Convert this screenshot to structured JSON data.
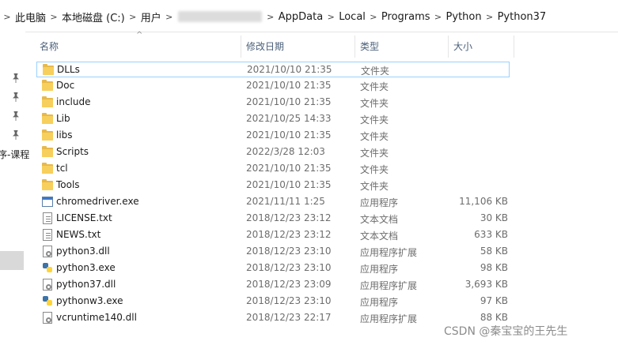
{
  "address": {
    "crumbs": [
      "此电脑",
      "本地磁盘 (C:)",
      "用户",
      "AppData",
      "Local",
      "Programs",
      "Python",
      "Python37"
    ],
    "separator": ">"
  },
  "columns": {
    "name": "名称",
    "date": "修改日期",
    "type": "类型",
    "size": "大小"
  },
  "nav": {
    "partial_label": "序-课程"
  },
  "files": [
    {
      "name": "DLLs",
      "date": "2021/10/10 21:35",
      "type": "文件夹",
      "size": "",
      "icon": "folder-icon"
    },
    {
      "name": "Doc",
      "date": "2021/10/10 21:35",
      "type": "文件夹",
      "size": "",
      "icon": "folder-icon"
    },
    {
      "name": "include",
      "date": "2021/10/10 21:35",
      "type": "文件夹",
      "size": "",
      "icon": "folder-icon"
    },
    {
      "name": "Lib",
      "date": "2021/10/25 14:33",
      "type": "文件夹",
      "size": "",
      "icon": "folder-icon"
    },
    {
      "name": "libs",
      "date": "2021/10/10 21:35",
      "type": "文件夹",
      "size": "",
      "icon": "folder-icon"
    },
    {
      "name": "Scripts",
      "date": "2022/3/28 12:03",
      "type": "文件夹",
      "size": "",
      "icon": "folder-icon"
    },
    {
      "name": "tcl",
      "date": "2021/10/10 21:35",
      "type": "文件夹",
      "size": "",
      "icon": "folder-icon"
    },
    {
      "name": "Tools",
      "date": "2021/10/10 21:35",
      "type": "文件夹",
      "size": "",
      "icon": "folder-icon"
    },
    {
      "name": "chromedriver.exe",
      "date": "2021/11/11 1:25",
      "type": "应用程序",
      "size": "11,106 KB",
      "icon": "exe-icon"
    },
    {
      "name": "LICENSE.txt",
      "date": "2018/12/23 23:12",
      "type": "文本文档",
      "size": "30 KB",
      "icon": "text-file-icon"
    },
    {
      "name": "NEWS.txt",
      "date": "2018/12/23 23:12",
      "type": "文本文档",
      "size": "633 KB",
      "icon": "text-file-icon"
    },
    {
      "name": "python3.dll",
      "date": "2018/12/23 23:10",
      "type": "应用程序扩展",
      "size": "58 KB",
      "icon": "dll-icon"
    },
    {
      "name": "python3.exe",
      "date": "2018/12/23 23:10",
      "type": "应用程序",
      "size": "98 KB",
      "icon": "python-icon"
    },
    {
      "name": "python37.dll",
      "date": "2018/12/23 23:09",
      "type": "应用程序扩展",
      "size": "3,693 KB",
      "icon": "dll-icon"
    },
    {
      "name": "pythonw3.exe",
      "date": "2018/12/23 23:10",
      "type": "应用程序",
      "size": "97 KB",
      "icon": "python-icon"
    },
    {
      "name": "vcruntime140.dll",
      "date": "2018/12/23 22:17",
      "type": "应用程序扩展",
      "size": "88 KB",
      "icon": "dll-icon"
    }
  ],
  "watermark": "CSDN @秦宝宝的王先生",
  "colors": {
    "folder": "#f7cf5c",
    "selection_border": "#99d1ff",
    "header_text": "#4c607a",
    "meta_text": "#6d6d6d"
  }
}
